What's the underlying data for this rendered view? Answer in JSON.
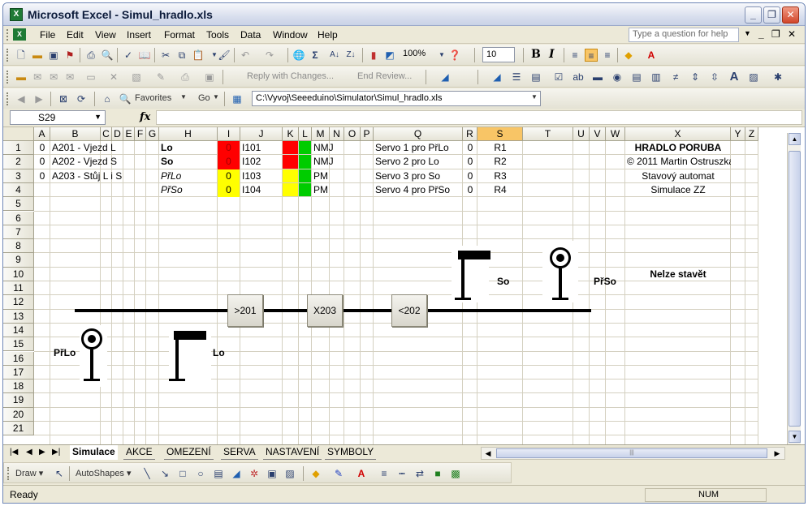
{
  "window": {
    "title": "Microsoft Excel - Simul_hradlo.xls",
    "app_icon": "X"
  },
  "menu": {
    "items": [
      {
        "label": "File",
        "u": "F",
        "rest": "ile"
      },
      {
        "label": "Edit",
        "u": "E",
        "rest": "dit"
      },
      {
        "label": "View",
        "u": "V",
        "rest": "iew"
      },
      {
        "label": "Insert",
        "u": "I",
        "rest": "nsert"
      },
      {
        "label": "Format",
        "u": "o",
        "rest": "Format"
      },
      {
        "label": "Tools",
        "u": "T",
        "rest": "ools"
      },
      {
        "label": "Data",
        "u": "D",
        "rest": "ata"
      },
      {
        "label": "Window",
        "u": "W",
        "rest": "indow"
      },
      {
        "label": "Help",
        "u": "H",
        "rest": "elp"
      }
    ],
    "help_placeholder": "Type a question for help"
  },
  "toolbar": {
    "zoom": "100%",
    "font_size": "10",
    "reply_text": "Reply with Changes...",
    "end_review": "End Review...",
    "favorites": "Favorites",
    "go": "Go",
    "path": "C:\\Vyvoj\\Seeeduino\\Simulator\\Simul_hradlo.xls"
  },
  "formula_bar": {
    "name_box": "S29",
    "fx": "fx",
    "value": ""
  },
  "columns": [
    {
      "letter": "A",
      "w": 20
    },
    {
      "letter": "B",
      "w": 62
    },
    {
      "letter": "C",
      "w": 14
    },
    {
      "letter": "D",
      "w": 14
    },
    {
      "letter": "E",
      "w": 14
    },
    {
      "letter": "F",
      "w": 14
    },
    {
      "letter": "G",
      "w": 16
    },
    {
      "letter": "H",
      "w": 72
    },
    {
      "letter": "I",
      "w": 28
    },
    {
      "letter": "J",
      "w": 52
    },
    {
      "letter": "K",
      "w": 20
    },
    {
      "letter": "L",
      "w": 16
    },
    {
      "letter": "M",
      "w": 22
    },
    {
      "letter": "N",
      "w": 18
    },
    {
      "letter": "O",
      "w": 20
    },
    {
      "letter": "P",
      "w": 16
    },
    {
      "letter": "Q",
      "w": 110
    },
    {
      "letter": "R",
      "w": 18
    },
    {
      "letter": "S",
      "w": 56
    },
    {
      "letter": "T",
      "w": 62
    },
    {
      "letter": "U",
      "w": 20
    },
    {
      "letter": "V",
      "w": 20
    },
    {
      "letter": "W",
      "w": 24
    },
    {
      "letter": "X",
      "w": 130
    },
    {
      "letter": "Y",
      "w": 18
    },
    {
      "letter": "Z",
      "w": 16
    }
  ],
  "rows": [
    "1",
    "2",
    "3",
    "4",
    "5",
    "6",
    "7",
    "8",
    "9",
    "10",
    "11",
    "12",
    "13",
    "14",
    "15",
    "16",
    "17",
    "18",
    "19",
    "20",
    "21"
  ],
  "selected_col": "S",
  "cells": [
    {
      "col": "A",
      "row": 1,
      "v": "0",
      "cls": "c"
    },
    {
      "col": "A",
      "row": 2,
      "v": "0",
      "cls": "c"
    },
    {
      "col": "A",
      "row": 3,
      "v": "0",
      "cls": "c"
    },
    {
      "col": "B",
      "row": 1,
      "v": "A201 - Vjezd L"
    },
    {
      "col": "B",
      "row": 2,
      "v": "A202 - Vjezd S"
    },
    {
      "col": "B",
      "row": 3,
      "v": "A203 - Stůj L i S"
    },
    {
      "col": "H",
      "row": 1,
      "v": "Lo",
      "cls": "b"
    },
    {
      "col": "H",
      "row": 2,
      "v": "So",
      "cls": "b"
    },
    {
      "col": "H",
      "row": 3,
      "v": "PřLo",
      "cls": "i"
    },
    {
      "col": "H",
      "row": 4,
      "v": "PřSo",
      "cls": "i"
    },
    {
      "col": "I",
      "row": 1,
      "v": "0",
      "cls": "c",
      "fill": "#ff0000",
      "color": "#a00000"
    },
    {
      "col": "I",
      "row": 2,
      "v": "0",
      "cls": "c",
      "fill": "#ff0000",
      "color": "#a00000"
    },
    {
      "col": "I",
      "row": 3,
      "v": "0",
      "cls": "c",
      "fill": "#ffff00"
    },
    {
      "col": "I",
      "row": 4,
      "v": "0",
      "cls": "c",
      "fill": "#ffff00"
    },
    {
      "col": "J",
      "row": 1,
      "v": "I101"
    },
    {
      "col": "J",
      "row": 2,
      "v": "I102"
    },
    {
      "col": "J",
      "row": 3,
      "v": "I103"
    },
    {
      "col": "J",
      "row": 4,
      "v": "I104"
    },
    {
      "col": "M",
      "row": 1,
      "v": "NMJ"
    },
    {
      "col": "M",
      "row": 2,
      "v": "NMJ"
    },
    {
      "col": "M",
      "row": 3,
      "v": "PM"
    },
    {
      "col": "M",
      "row": 4,
      "v": "PM"
    },
    {
      "col": "Q",
      "row": 1,
      "v": "Servo 1 pro PřLo"
    },
    {
      "col": "Q",
      "row": 2,
      "v": "Servo 2 pro Lo"
    },
    {
      "col": "Q",
      "row": 3,
      "v": "Servo 3 pro So"
    },
    {
      "col": "Q",
      "row": 4,
      "v": "Servo 4 pro PřSo"
    },
    {
      "col": "R",
      "row": 1,
      "v": "0",
      "cls": "c"
    },
    {
      "col": "R",
      "row": 2,
      "v": "0",
      "cls": "c"
    },
    {
      "col": "R",
      "row": 3,
      "v": "0",
      "cls": "c"
    },
    {
      "col": "R",
      "row": 4,
      "v": "0",
      "cls": "c"
    },
    {
      "col": "S",
      "row": 1,
      "v": "R1",
      "cls": "c"
    },
    {
      "col": "S",
      "row": 2,
      "v": "R2",
      "cls": "c"
    },
    {
      "col": "S",
      "row": 3,
      "v": "R3",
      "cls": "c"
    },
    {
      "col": "S",
      "row": 4,
      "v": "R4",
      "cls": "c"
    },
    {
      "col": "X",
      "row": 1,
      "v": "HRADLO PORUBA",
      "cls": "b c"
    },
    {
      "col": "X",
      "row": 2,
      "v": "© 2011 Martin Ostruszka",
      "cls": "c"
    },
    {
      "col": "X",
      "row": 3,
      "v": "Stavový automat",
      "cls": "c"
    },
    {
      "col": "X",
      "row": 4,
      "v": "Simulace ZZ",
      "cls": "c"
    },
    {
      "col": "X",
      "row": 10,
      "v": "Nelze stavět",
      "cls": "b c"
    }
  ],
  "fills": [
    {
      "col": "K",
      "row": 1,
      "color": "#ff0000"
    },
    {
      "col": "L",
      "row": 1,
      "color": "#00cc00"
    },
    {
      "col": "K",
      "row": 2,
      "color": "#ff0000"
    },
    {
      "col": "L",
      "row": 2,
      "color": "#00cc00"
    },
    {
      "col": "K",
      "row": 3,
      "color": "#ffff00"
    },
    {
      "col": "L",
      "row": 3,
      "color": "#00cc00"
    },
    {
      "col": "K",
      "row": 4,
      "color": "#ffff00"
    },
    {
      "col": "L",
      "row": 4,
      "color": "#00cc00"
    }
  ],
  "diagram": {
    "buttons": [
      ">201",
      "X203",
      "<202"
    ],
    "labels": {
      "so": "So",
      "priso": "PřSo",
      "prilo": "PřLo",
      "lo": "Lo"
    }
  },
  "sheets": [
    {
      "label": "Simulace",
      "active": true
    },
    {
      "label": "AKCE"
    },
    {
      "label": "OMEZENÍ"
    },
    {
      "label": "SERVA"
    },
    {
      "label": "NASTAVENÍ"
    },
    {
      "label": "SYMBOLY"
    }
  ],
  "drawbar": {
    "draw": "Draw",
    "autoshapes": "AutoShapes"
  },
  "status": {
    "ready": "Ready",
    "num": "NUM"
  }
}
